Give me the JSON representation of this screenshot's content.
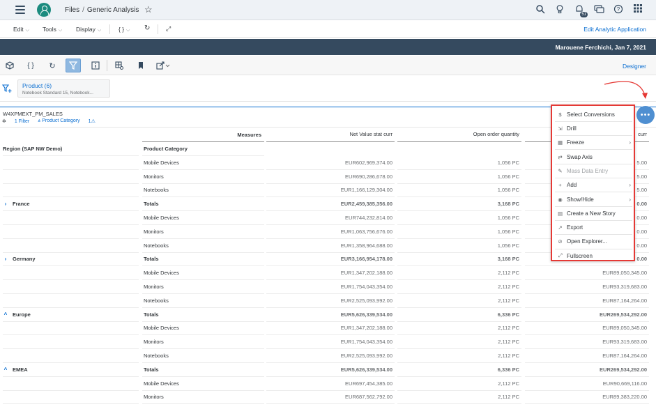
{
  "shell": {
    "breadcrumb_root": "Files",
    "breadcrumb_sep": "/",
    "breadcrumb_page": "Generic Analysis",
    "notification_count": "51"
  },
  "menubar": {
    "edit": "Edit",
    "tools": "Tools",
    "display": "Display",
    "code": "{ }",
    "edit_app": "Edit Analytic Application"
  },
  "darkbar": {
    "user_date": "Marouene Ferchichi, Jan 7, 2021"
  },
  "toolbar": {
    "designer": "Designer"
  },
  "filterbar": {
    "token_title": "Product (6)",
    "token_values": "Notebook Standard 15, Notebook..."
  },
  "widget": {
    "title": "W4XPMEXT_PM_SALES",
    "filter_count": "1 Filter",
    "filter_dim": "Product Category",
    "warn_count": "1"
  },
  "table": {
    "measures_label": "Measures",
    "col_v1": "Net Value stat curr",
    "col_v2": "Open order quantity",
    "col_v3": "curr",
    "region_header": "Region (SAP NW Demo)",
    "category_header": "Product Category",
    "rows": [
      {
        "region": "",
        "expander": "",
        "cat": "Mobile Devices",
        "v1": "EUR602,969,374.00",
        "v2": "1,056 PC",
        "v3": "5.00",
        "bold": false
      },
      {
        "region": "",
        "expander": "",
        "cat": "Monitors",
        "v1": "EUR690,286,678.00",
        "v2": "1,056 PC",
        "v3": "5.00",
        "bold": false
      },
      {
        "region": "",
        "expander": "",
        "cat": "Notebooks",
        "v1": "EUR1,166,129,304.00",
        "v2": "1,056 PC",
        "v3": "5.00",
        "bold": false
      },
      {
        "region": "France",
        "expander": "›",
        "cat": "Totals",
        "v1": "EUR2,459,385,356.00",
        "v2": "3,168 PC",
        "v3": "0.00",
        "bold": true
      },
      {
        "region": "",
        "expander": "",
        "cat": "Mobile Devices",
        "v1": "EUR744,232,814.00",
        "v2": "1,056 PC",
        "v3": "0.00",
        "bold": false
      },
      {
        "region": "",
        "expander": "",
        "cat": "Monitors",
        "v1": "EUR1,063,756,676.00",
        "v2": "1,056 PC",
        "v3": "0.00",
        "bold": false
      },
      {
        "region": "",
        "expander": "",
        "cat": "Notebooks",
        "v1": "EUR1,358,964,688.00",
        "v2": "1,056 PC",
        "v3": "0.00",
        "bold": false
      },
      {
        "region": "Germany",
        "expander": "›",
        "cat": "Totals",
        "v1": "EUR3,166,954,178.00",
        "v2": "3,168 PC",
        "v3": "0.00",
        "bold": true
      },
      {
        "region": "",
        "expander": "",
        "cat": "Mobile Devices",
        "v1": "EUR1,347,202,188.00",
        "v2": "2,112 PC",
        "v3": "EUR89,050,345.00",
        "bold": false
      },
      {
        "region": "",
        "expander": "",
        "cat": "Monitors",
        "v1": "EUR1,754,043,354.00",
        "v2": "2,112 PC",
        "v3": "EUR93,319,683.00",
        "bold": false
      },
      {
        "region": "",
        "expander": "",
        "cat": "Notebooks",
        "v1": "EUR2,525,093,992.00",
        "v2": "2,112 PC",
        "v3": "EUR87,164,264.00",
        "bold": false
      },
      {
        "region": "Europe",
        "expander": "^",
        "cat": "Totals",
        "v1": "EUR5,626,339,534.00",
        "v2": "6,336 PC",
        "v3": "EUR269,534,292.00",
        "bold": true
      },
      {
        "region": "",
        "expander": "",
        "cat": "Mobile Devices",
        "v1": "EUR1,347,202,188.00",
        "v2": "2,112 PC",
        "v3": "EUR89,050,345.00",
        "bold": false
      },
      {
        "region": "",
        "expander": "",
        "cat": "Monitors",
        "v1": "EUR1,754,043,354.00",
        "v2": "2,112 PC",
        "v3": "EUR93,319,683.00",
        "bold": false
      },
      {
        "region": "",
        "expander": "",
        "cat": "Notebooks",
        "v1": "EUR2,525,093,992.00",
        "v2": "2,112 PC",
        "v3": "EUR87,164,264.00",
        "bold": false
      },
      {
        "region": "EMEA",
        "expander": "^",
        "cat": "Totals",
        "v1": "EUR5,626,339,534.00",
        "v2": "6,336 PC",
        "v3": "EUR269,534,292.00",
        "bold": true
      },
      {
        "region": "",
        "expander": "",
        "cat": "Mobile Devices",
        "v1": "EUR697,454,385.00",
        "v2": "2,112 PC",
        "v3": "EUR90,669,116.00",
        "bold": false
      },
      {
        "region": "",
        "expander": "",
        "cat": "Monitors",
        "v1": "EUR687,562,792.00",
        "v2": "2,112 PC",
        "v3": "EUR89,383,220.00",
        "bold": false
      }
    ]
  },
  "context_menu": {
    "more_label": "•••",
    "items": [
      {
        "icon": "$",
        "icon_name": "currency-icon",
        "label": "Select Conversions",
        "submenu": false,
        "disabled": false
      },
      {
        "icon": "⇲",
        "icon_name": "drill-icon",
        "label": "Drill",
        "submenu": false,
        "disabled": false
      },
      {
        "icon": "▦",
        "icon_name": "freeze-icon",
        "label": "Freeze",
        "submenu": true,
        "disabled": false
      },
      {
        "icon": "⇄",
        "icon_name": "swap-axis-icon",
        "label": "Swap Axis",
        "submenu": false,
        "disabled": false
      },
      {
        "icon": "✎",
        "icon_name": "mass-data-entry-icon",
        "label": "Mass Data Entry",
        "submenu": false,
        "disabled": true
      },
      {
        "icon": "+",
        "icon_name": "add-icon",
        "label": "Add",
        "submenu": true,
        "disabled": false
      },
      {
        "icon": "◉",
        "icon_name": "show-hide-icon",
        "label": "Show/Hide",
        "submenu": true,
        "disabled": false
      },
      {
        "icon": "▤",
        "icon_name": "create-story-icon",
        "label": "Create a New Story",
        "submenu": false,
        "disabled": false
      },
      {
        "icon": "↗",
        "icon_name": "export-icon",
        "label": "Export",
        "submenu": false,
        "disabled": false
      },
      {
        "icon": "⊘",
        "icon_name": "explorer-icon",
        "label": "Open Explorer...",
        "submenu": false,
        "disabled": false
      },
      {
        "icon": "⤢",
        "icon_name": "fullscreen-icon",
        "label": "Fullscreen",
        "submenu": false,
        "disabled": false
      }
    ]
  },
  "colors": {
    "shell_bg": "#eef2f6",
    "dark_bar": "#354a5f",
    "accent": "#0a6ed1",
    "highlight_border": "#e53935"
  }
}
